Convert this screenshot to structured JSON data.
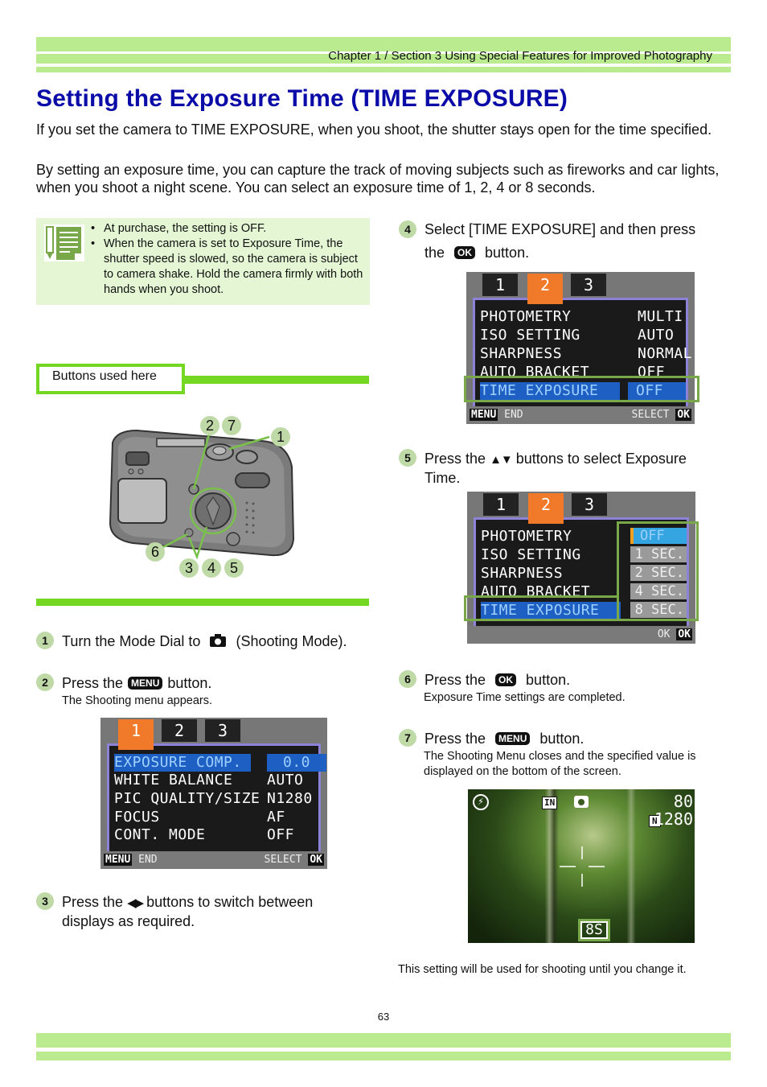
{
  "header": {
    "chapter": "Chapter 1 / Section 3  Using Special Features for Improved Photography"
  },
  "title": "Setting the Exposure Time (TIME EXPOSURE)",
  "intro": [
    "If you set the camera to TIME EXPOSURE, when you shoot, the shutter stays open for the time specified.",
    "By setting an exposure time,  you can capture the track of moving subjects such as fireworks and car lights, when you shoot a night scene. You can select an exposure time of 1, 2, 4 or 8 seconds."
  ],
  "note": {
    "icon": "memo-pencil-icon",
    "items": [
      "At purchase, the setting is OFF.",
      "When the camera is set to Exposure Time, the shutter speed is slowed, so the camera is subject to camera shake. Hold the camera firmly with both hands when you shoot."
    ]
  },
  "buttons_used": {
    "label": "Buttons used here",
    "callouts": [
      "2",
      "7",
      "1",
      "6",
      "3",
      "4",
      "5"
    ]
  },
  "steps": [
    {
      "num": "1",
      "pre": "Turn the Mode Dial to",
      "icon": "camera-icon",
      "post": "(Shooting Mode)."
    },
    {
      "num": "2",
      "pre": "Press the",
      "key": "MENU",
      "post": "button.",
      "sub": "The Shooting menu appears."
    },
    {
      "num": "3",
      "pre": "Press the",
      "arrows": "◀▶",
      "post": "buttons to switch between",
      "line2": "displays as required."
    },
    {
      "num": "4",
      "pre": "Select  [TIME EXPOSURE] and then press",
      "line2_pre": "the",
      "key": "OK",
      "line2_post": "button."
    },
    {
      "num": "5",
      "pre": "Press the",
      "arrows": "▲▼",
      "post": "buttons to select Exposure",
      "line2": "Time."
    },
    {
      "num": "6",
      "pre": "Press the",
      "key": "OK",
      "post": "button.",
      "sub": "Exposure Time settings are completed."
    },
    {
      "num": "7",
      "pre": "Press the",
      "key": "MENU",
      "post": "button.",
      "sub": "The Shooting Menu closes and the specified value is displayed on the bottom of the screen."
    }
  ],
  "screen1": {
    "tabs": [
      "1",
      "2",
      "3"
    ],
    "active_tab": "1",
    "rows": [
      {
        "k": "EXPOSURE COMP.",
        "v": "0.0"
      },
      {
        "k": "WHITE BALANCE",
        "v": "AUTO"
      },
      {
        "k": "PIC QUALITY/SIZE",
        "v": "N1280"
      },
      {
        "k": "FOCUS",
        "v": "AF"
      },
      {
        "k": "CONT. MODE",
        "v": "OFF"
      }
    ],
    "footer_left_key": "MENU",
    "footer_left": "END",
    "footer_right": "SELECT",
    "footer_right_key": "OK"
  },
  "screen2": {
    "tabs": [
      "1",
      "2",
      "3"
    ],
    "active_tab": "2",
    "rows": [
      {
        "k": "PHOTOMETRY",
        "v": "MULTI"
      },
      {
        "k": "ISO SETTING",
        "v": "AUTO"
      },
      {
        "k": "SHARPNESS",
        "v": "NORMAL"
      },
      {
        "k": "AUTO BRACKET",
        "v": "OFF"
      },
      {
        "k": "TIME EXPOSURE",
        "v": "OFF"
      }
    ],
    "footer_left_key": "MENU",
    "footer_left": "END",
    "footer_right": "SELECT",
    "footer_right_key": "OK"
  },
  "screen3": {
    "tabs": [
      "1",
      "2",
      "3"
    ],
    "active_tab": "2",
    "rows": [
      {
        "k": "PHOTOMETRY"
      },
      {
        "k": "ISO SETTING"
      },
      {
        "k": "SHARPNESS"
      },
      {
        "k": "AUTO BRACKET"
      },
      {
        "k": "TIME EXPOSURE"
      }
    ],
    "options": [
      "OFF",
      "1 SEC.",
      "2 SEC.",
      "4 SEC.",
      "8 SEC."
    ],
    "selected_option": "OFF",
    "footer_right": "OK",
    "footer_right_key": "OK"
  },
  "preview": {
    "flash_icon": "flash-off-icon",
    "memory_label": "IN",
    "mode_icon": "camera-mode-icon",
    "shots_remaining": "80",
    "quality_label": "N",
    "size": "1280",
    "exposure_badge": "8S"
  },
  "footer_note": "This setting will be used for shooting until you change it.",
  "page_number": "63"
}
